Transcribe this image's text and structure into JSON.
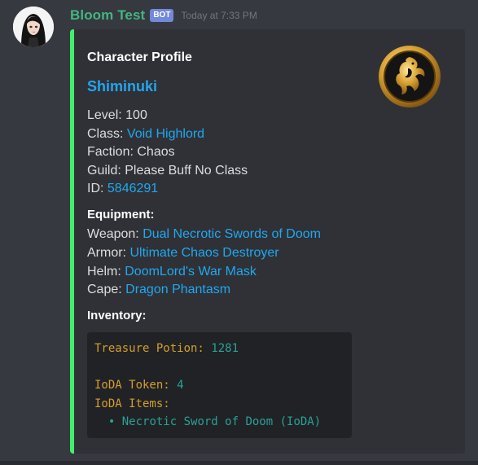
{
  "message": {
    "username": "Bloom Test",
    "bot_tag": "BOT",
    "timestamp": "Today at 7:33 PM"
  },
  "embed": {
    "accent_color": "#43ee6e",
    "title": "Character Profile",
    "character_name": "Shiminuki",
    "stats": {
      "level_label": "Level: ",
      "level_value": "100",
      "class_label": "Class: ",
      "class_value": "Void Highlord",
      "faction_label": "Faction: ",
      "faction_value": "Chaos",
      "guild_label": "Guild: ",
      "guild_value": "Please Buff No Class",
      "id_label": "ID: ",
      "id_value": "5846291"
    },
    "equipment": {
      "heading": "Equipment:",
      "weapon_label": "Weapon: ",
      "weapon_value": "Dual Necrotic Swords of Doom",
      "armor_label": "Armor: ",
      "armor_value": "Ultimate Chaos Destroyer",
      "helm_label": "Helm: ",
      "helm_value": "DoomLord's War Mask",
      "cape_label": "Cape: ",
      "cape_value": "Dragon Phantasm"
    },
    "inventory": {
      "heading": "Inventory:",
      "treasure_label": "Treasure Potion: ",
      "treasure_value": "1281",
      "ioda_token_label": "IoDA Token: ",
      "ioda_token_value": "4",
      "ioda_items_label": "IoDA Items:",
      "ioda_item_bullet": "•",
      "ioda_item": "Necrotic Sword of Doom (IoDA)"
    },
    "thumbnail_icon": "golden-dragon-emblem-icon"
  }
}
